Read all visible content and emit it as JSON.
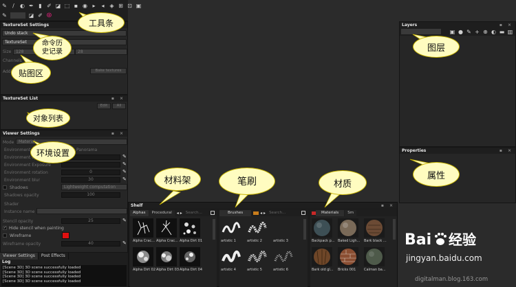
{
  "toolbar": {
    "row1_icons": [
      "paint-icon",
      "smudge-icon",
      "eraser-icon",
      "clone-icon",
      "fill-icon",
      "picker-icon",
      "select-icon",
      "projection-icon",
      "scene-icon",
      "eye-icon",
      "mask-icon",
      "brush-icon",
      "display-icon",
      "render-icon",
      "settings-icon",
      "camera-icon"
    ],
    "row2_icons": [
      "pen-icon",
      "symmetry-icon",
      "pencil-icon",
      "substance-icon"
    ]
  },
  "texture_set_settings": {
    "title": "TextureSet Settings",
    "undo_stack": "Undo stack",
    "texture_set": "TextureSet",
    "size_label": "Size",
    "size_value": "128",
    "size_value2": "28",
    "channels_label": "Channels",
    "additional_label": "Additional",
    "bake_button": "Bake textures"
  },
  "texture_set_list": {
    "title": "TextureSet List",
    "edit_button": "Edit",
    "all_button": "All"
  },
  "viewer_settings": {
    "title": "Viewer Settings",
    "mode_label": "Mode",
    "mode_value": "Material",
    "env_map_label": "Environment map",
    "env_map_value": "Panorama",
    "env_opacity_label": "Environment opacity",
    "env_exposure_label": "Environment Exposure",
    "env_rotation_label": "Environment rotation",
    "env_rotation_value": "0",
    "env_blur_label": "Environment blur",
    "env_blur_value": "30",
    "shadows_label": "Shadows",
    "shadows_value": "Lightweight computation",
    "shadows_opacity_label": "Shadows opacity",
    "shadows_opacity_value": "100",
    "shader_label": "Shader",
    "instance_name_label": "Instance name",
    "stencil_opacity_label": "Stencil opacity",
    "stencil_opacity_value": "25",
    "hide_stencil_label": "Hide stencil when painting",
    "wireframe_label": "Wireframe",
    "wireframe_color": "#e01010",
    "wireframe_opacity_label": "Wireframe opacity",
    "wireframe_opacity_value": "40"
  },
  "bottom_tabs": [
    "Viewer Settings",
    "Post Effects"
  ],
  "log": {
    "title": "Log",
    "lines": [
      "[Scene 3D] 3D scene successfully loaded",
      "[Scene 3D] 3D scene successfully loaded",
      "[Scene 3D] 3D scene successfully loaded",
      "[Scene 3D] 3D scene successfully loaded"
    ]
  },
  "layers": {
    "title": "Layers",
    "toolbar_icons": [
      "folder-icon",
      "circle-icon",
      "brush-icon",
      "add-icon",
      "copy-icon",
      "fill-icon",
      "folder-icon",
      "trash-icon"
    ]
  },
  "properties": {
    "title": "Properties"
  },
  "shelf": {
    "title": "Shelf",
    "alphas": {
      "tabs": [
        "Alphas",
        "Procedural"
      ],
      "search": "Search...",
      "items": [
        "Alpha Crac...",
        "Alpha Crac...",
        "Alpha Dirt 01",
        "Alpha Dirt 02",
        "Alpha Dirt 03",
        "Alpha Dirt 04"
      ]
    },
    "brushes": {
      "tabs": [
        "Brushes"
      ],
      "search": "Search...",
      "items": [
        "artistic 1",
        "artistic 2",
        "artistic 3",
        "artistic 4",
        "artistic 5",
        "artistic 6"
      ]
    },
    "materials": {
      "tabs": [
        "Materials",
        "Sm"
      ],
      "items": [
        "Backpack p...",
        "Baked Ligh...",
        "Bark black ...",
        "Bark old gl...",
        "Bricks 001",
        "Calman ba..."
      ],
      "swatches": [
        "#3d4f55",
        "#7a6a58",
        "#6b4a34",
        "#6e4628",
        "#8a4e32",
        "#4e5a4a"
      ]
    }
  },
  "annotations": {
    "toolbar": "工具条",
    "history": "命令历\n史记录",
    "texture_area": "贴图区",
    "object_list": "对象列表",
    "env_settings": "环境设置",
    "layers": "图层",
    "properties": "属性",
    "shelf": "材料架",
    "brushes": "笔刷",
    "materials": "材质"
  },
  "watermark": {
    "logo_text": "Bai",
    "logo_text2": "经验",
    "url": "jingyan.baidu.com",
    "blog": "digitalman.blog.163.com"
  }
}
